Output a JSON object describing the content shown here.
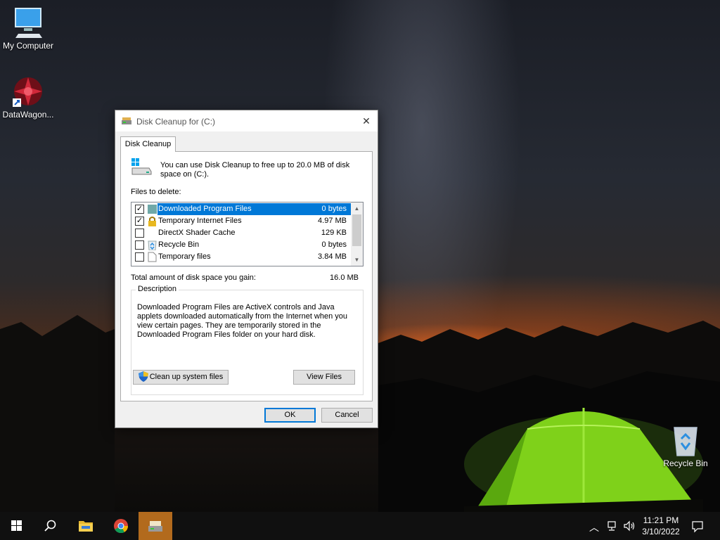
{
  "desktop": {
    "icons": [
      {
        "label": "My Computer",
        "icon": "monitor-icon"
      },
      {
        "label": "DataWagon...",
        "icon": "datawagon-icon"
      },
      {
        "label": "Recycle Bin",
        "icon": "recycle-bin-icon"
      }
    ]
  },
  "dialog": {
    "title": "Disk Cleanup for  (C:)",
    "close_glyph": "✕",
    "tab_label": "Disk Cleanup",
    "intro_text": "You can use Disk Cleanup to free up to 20.0 MB of disk space on  (C:).",
    "files_label": "Files to delete:",
    "files": [
      {
        "name": "Downloaded Program Files",
        "size": "0 bytes",
        "checked": true,
        "selected": true,
        "icon": "folder-icon"
      },
      {
        "name": "Temporary Internet Files",
        "size": "4.97 MB",
        "checked": true,
        "selected": false,
        "icon": "lock-icon"
      },
      {
        "name": "DirectX Shader Cache",
        "size": "129 KB",
        "checked": false,
        "selected": false,
        "icon": "none"
      },
      {
        "name": "Recycle Bin",
        "size": "0 bytes",
        "checked": false,
        "selected": false,
        "icon": "recycle-icon"
      },
      {
        "name": "Temporary files",
        "size": "3.84 MB",
        "checked": false,
        "selected": false,
        "icon": "file-icon"
      }
    ],
    "check_glyph": "✓",
    "total_label": "Total amount of disk space you gain:",
    "total_value": "16.0 MB",
    "description_legend": "Description",
    "description_text": "Downloaded Program Files are ActiveX controls and Java applets downloaded automatically from the Internet when you view certain pages. They are temporarily stored in the Downloaded Program Files folder on your hard disk.",
    "buttons": {
      "cleanup": "Clean up system files",
      "view_files": "View Files",
      "ok": "OK",
      "cancel": "Cancel"
    }
  },
  "taskbar": {
    "items": [
      "start-icon",
      "search-icon",
      "file-explorer-icon",
      "chrome-icon",
      "disk-cleanup-icon"
    ],
    "clock_time": "11:21 PM",
    "clock_date": "3/10/2022"
  },
  "colors": {
    "accent": "#0078d7",
    "taskbar": "#101010",
    "active_task": "#b26a1d"
  }
}
